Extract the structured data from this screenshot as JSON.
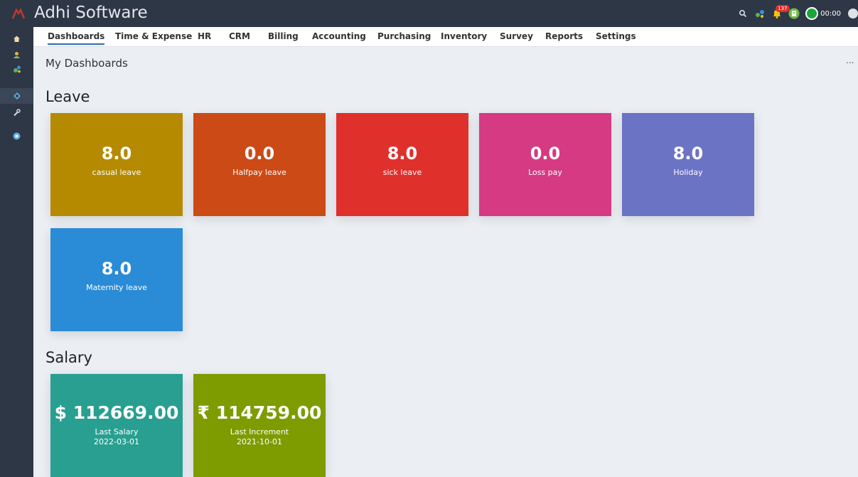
{
  "app": {
    "title": "Adhi Software"
  },
  "header": {
    "notification_count": "137",
    "timer": "00:00"
  },
  "nav": {
    "items": [
      {
        "label": "Dashboards",
        "active": true
      },
      {
        "label": "Time & Expense"
      },
      {
        "label": "HR"
      },
      {
        "label": "CRM"
      },
      {
        "label": "Billing"
      },
      {
        "label": "Accounting"
      },
      {
        "label": "Purchasing"
      },
      {
        "label": "Inventory"
      },
      {
        "label": "Survey"
      },
      {
        "label": "Reports"
      },
      {
        "label": "Settings"
      }
    ]
  },
  "sidebar": {
    "icons": [
      "home-icon",
      "user-icon",
      "puzzle-icon",
      "dashboard-icon",
      "wrench-icon",
      "help-icon"
    ],
    "active_index": 3
  },
  "page": {
    "title": "My Dashboards",
    "more": "..."
  },
  "leave": {
    "heading": "Leave",
    "tiles": [
      {
        "value": "8.0",
        "label": "casual leave",
        "color": "#b58a00"
      },
      {
        "value": "0.0",
        "label": "Halfpay leave",
        "color": "#cb4a15"
      },
      {
        "value": "8.0",
        "label": "sick leave",
        "color": "#df302c"
      },
      {
        "value": "0.0",
        "label": "Loss pay",
        "color": "#d53a83"
      },
      {
        "value": "8.0",
        "label": "Holiday",
        "color": "#6b73c5"
      },
      {
        "value": "8.0",
        "label": "Maternity leave",
        "color": "#2a8bd6"
      }
    ]
  },
  "salary": {
    "heading": "Salary",
    "tiles": [
      {
        "value": "$ 112669.00",
        "label": "Last Salary",
        "date": "2022-03-01",
        "color": "#289f91"
      },
      {
        "value": "₹ 114759.00",
        "label": "Last Increment",
        "date": "2021-10-01",
        "color": "#7e9b00"
      }
    ]
  },
  "colors": {
    "topbar": "#2e3746",
    "background": "#ebeef3",
    "accent": "#2f6db5"
  }
}
